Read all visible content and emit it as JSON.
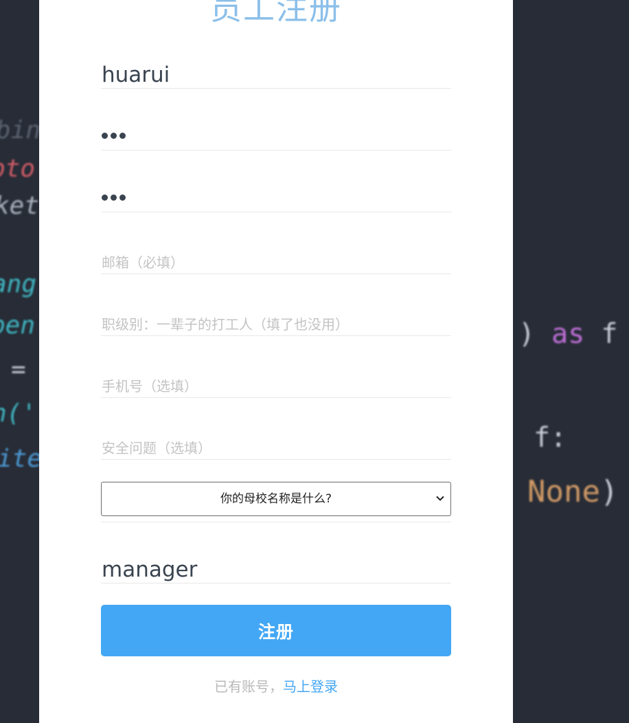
{
  "background_code": {
    "left_lines": [
      "binn",
      "pto",
      "ket",
      "ang",
      "pen",
      "=",
      "n('",
      "ite"
    ],
    "right_lines": [
      ") as f",
      "f:",
      "None)"
    ]
  },
  "form": {
    "title": "员工注册",
    "username_value": "huarui",
    "password_dots": 3,
    "confirm_password_dots": 3,
    "email_placeholder": "邮箱（必填）",
    "level_placeholder": "职级别：一辈子的打工人（填了也没用）",
    "phone_placeholder": "手机号（选填）",
    "security_question_placeholder": "安全问题（选填）",
    "security_question_select_value": "你的母校名称是什么?",
    "answer_value": "manager",
    "submit_label": "注册",
    "footer_text": "已有账号，",
    "footer_link": "马上登录"
  },
  "colors": {
    "title": "#8bbfe9",
    "button": "#43a7f5",
    "link": "#43a7f5",
    "background": "#272c36"
  }
}
